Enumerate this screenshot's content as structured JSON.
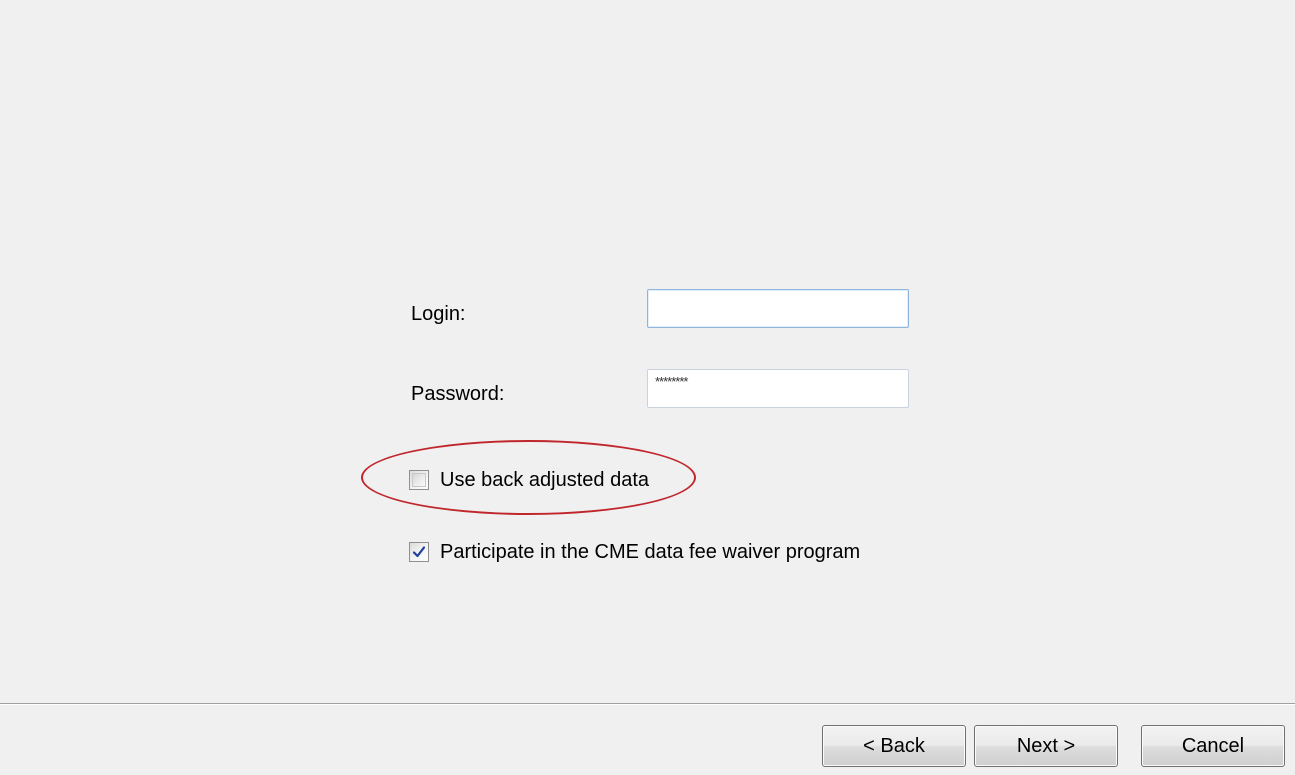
{
  "form": {
    "login_label": "Login:",
    "login_value": "",
    "password_label": "Password:",
    "password_value": "********",
    "back_adjusted": {
      "label": "Use back adjusted data",
      "checked": false
    },
    "fee_waiver": {
      "label": "Participate in the CME data fee waiver program",
      "checked": true
    }
  },
  "buttons": {
    "back_label": "< Back",
    "next_label": "Next >",
    "cancel_label": "Cancel"
  },
  "colors": {
    "dialog_background": "#f0f0f0",
    "highlight_ellipse": "#c0272d",
    "checkmark": "#1f3f9c"
  },
  "annotations": {
    "highlighted_option": "back_adjusted"
  }
}
